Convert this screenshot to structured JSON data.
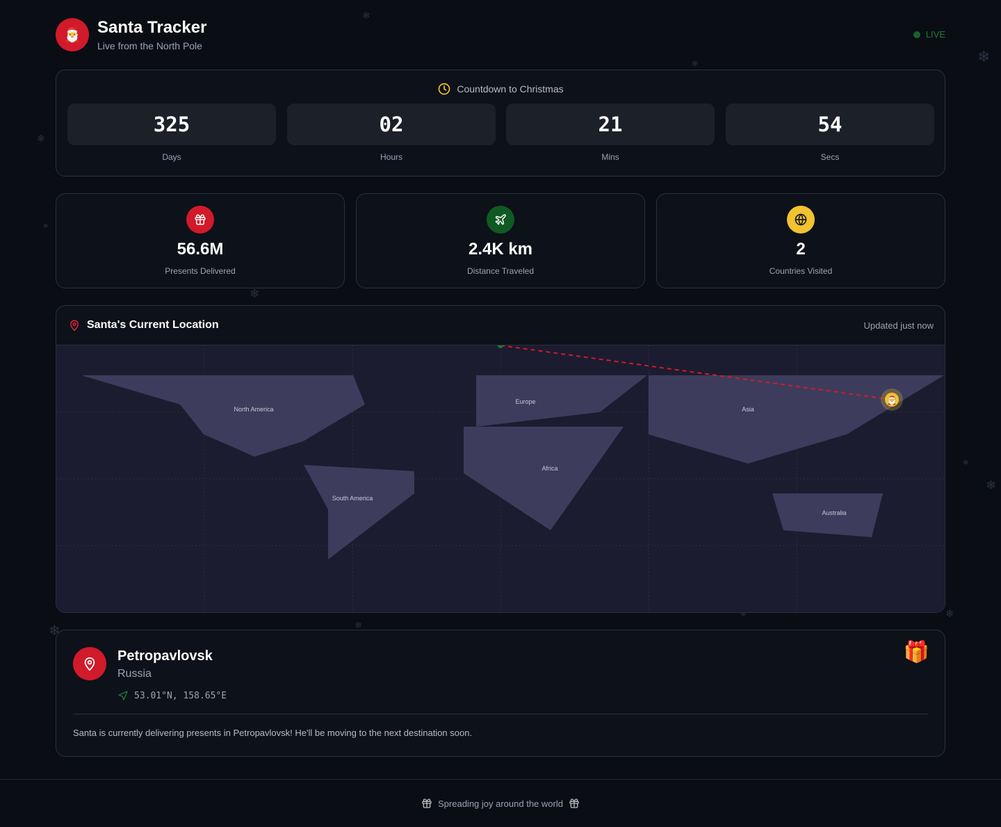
{
  "header": {
    "title": "Santa Tracker",
    "subtitle": "Live from the North Pole",
    "logo_icon": "santa-emoji",
    "live_label": "LIVE",
    "live_color": "#16632b"
  },
  "countdown": {
    "heading": "Countdown to Christmas",
    "units": [
      {
        "value": "325",
        "label": "Days"
      },
      {
        "value": "02",
        "label": "Hours"
      },
      {
        "value": "21",
        "label": "Mins"
      },
      {
        "value": "54",
        "label": "Secs"
      }
    ]
  },
  "stats": [
    {
      "icon": "gift-icon",
      "color": "#d11a2a",
      "value": "56.6M",
      "label": "Presents Delivered"
    },
    {
      "icon": "plane-icon",
      "color": "#0f5a22",
      "value": "2.4K km",
      "label": "Distance Traveled"
    },
    {
      "icon": "globe-icon",
      "color": "#f2c230",
      "value": "2",
      "label": "Countries Visited"
    }
  ],
  "map": {
    "title": "Santa's Current Location",
    "updated": "Updated just now",
    "continents": {
      "north_america": "North America",
      "south_america": "South America",
      "europe": "Europe",
      "africa": "Africa",
      "asia": "Asia",
      "australia": "Australia"
    },
    "route_color": "#d11a2a"
  },
  "location": {
    "city": "Petropavlovsk",
    "country": "Russia",
    "coords": "53.01°N, 158.65°E",
    "description": "Santa is currently delivering presents in Petropavlovsk! He'll be moving to the next destination soon."
  },
  "footer": {
    "text": "Spreading joy around the world"
  }
}
